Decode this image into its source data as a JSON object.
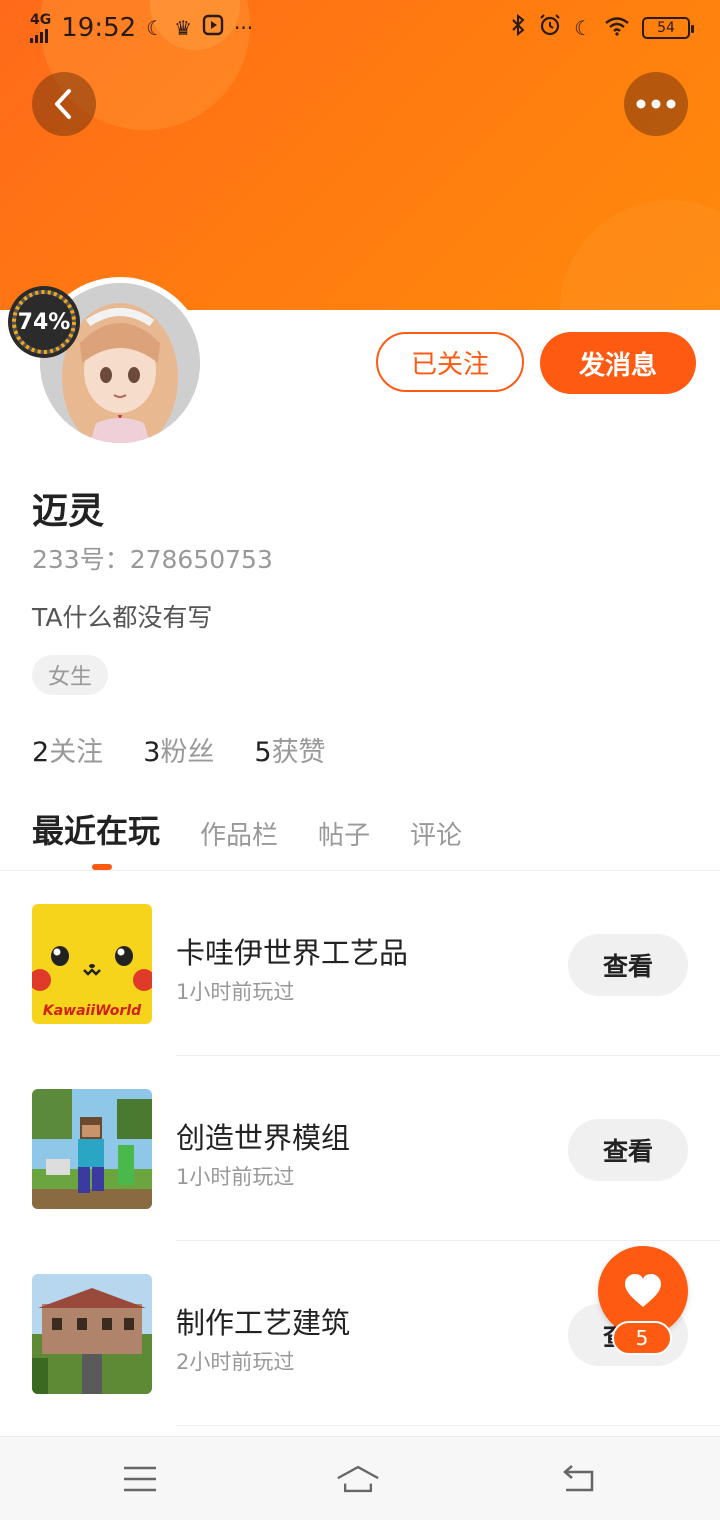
{
  "status_bar": {
    "network": "4G",
    "time": "19:52",
    "more_glyph": "···",
    "battery": "54",
    "icons": [
      "signal-icon",
      "moon-icon",
      "crown-icon",
      "play-icon",
      "bluetooth-icon",
      "alarm-icon",
      "moon-icon",
      "wifi-icon",
      "battery-icon"
    ]
  },
  "header": {
    "back_icon": "chevron-left-icon",
    "more_icon": "more-dots-icon",
    "accent_color": "#ff5a12"
  },
  "profile": {
    "avatar_badge": "74%",
    "follow_label": "已关注",
    "message_label": "发消息",
    "name": "迈灵",
    "uid": "233号：278650753",
    "bio": "TA什么都没有写",
    "gender_tag": "女生",
    "stats": [
      {
        "count": "2",
        "label": "关注"
      },
      {
        "count": "3",
        "label": "粉丝"
      },
      {
        "count": "5",
        "label": "获赞"
      }
    ]
  },
  "tabs": [
    {
      "label": "最近在玩",
      "active": true
    },
    {
      "label": "作品栏",
      "active": false
    },
    {
      "label": "帖子",
      "active": false
    },
    {
      "label": "评论",
      "active": false
    }
  ],
  "games": [
    {
      "title": "卡哇伊世界工艺品",
      "subtitle": "1小时前玩过",
      "button": "查看",
      "thumb_text": "KawaiiWorld"
    },
    {
      "title": "创造世界模组",
      "subtitle": "1小时前玩过",
      "button": "查看"
    },
    {
      "title": "制作工艺建筑",
      "subtitle": "2小时前玩过",
      "button": "查看"
    }
  ],
  "like_fab": {
    "count": "5",
    "icon": "heart-icon"
  },
  "nav": {
    "icons": [
      "menu-icon",
      "home-icon",
      "back-icon"
    ]
  }
}
